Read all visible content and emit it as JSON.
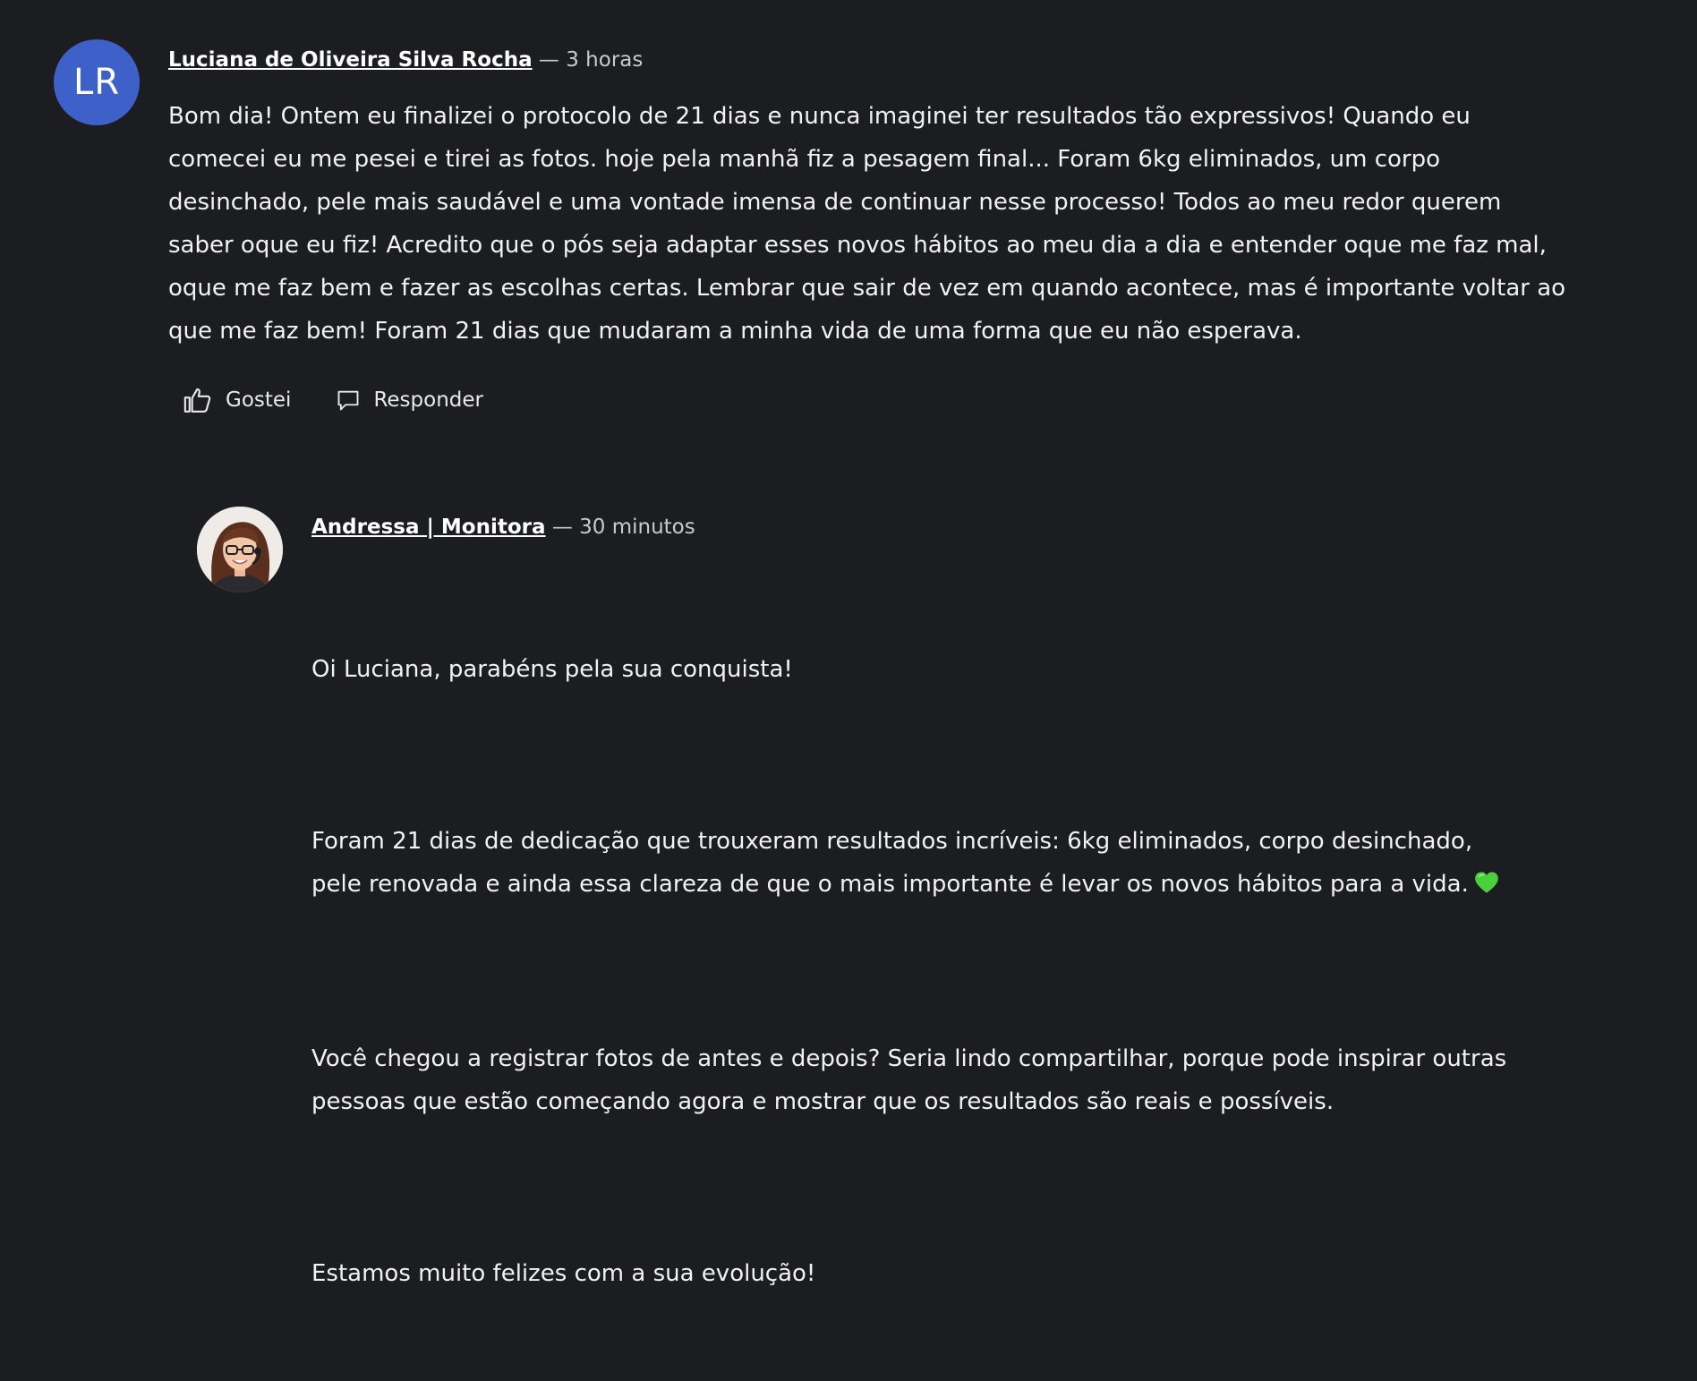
{
  "main_comment": {
    "avatar_initials": "LR",
    "author": "Luciana de Oliveira Silva Rocha",
    "timestamp": "— 3 horas",
    "text": "Bom dia! Ontem eu finalizei o protocolo de 21 dias e nunca imaginei ter resultados tão expressivos! Quando eu comecei eu me pesei e tirei as fotos. hoje pela manhã fiz a pesagem final... Foram 6kg eliminados, um corpo desinchado, pele mais saudável e uma vontade imensa de continuar nesse processo! Todos ao meu redor querem saber oque eu fiz! Acredito que o pós seja adaptar esses novos hábitos ao meu dia a dia e entender oque me faz mal, oque me faz bem e fazer as escolhas certas. Lembrar que sair de vez em quando acontece, mas é importante voltar ao que me faz bem! Foram 21 dias que mudaram a minha vida de uma forma que eu não esperava.",
    "actions": {
      "like_label": "Gostei",
      "reply_label": "Responder"
    }
  },
  "reply_comment": {
    "author": "Andressa | Monitora",
    "timestamp": "— 30 minutos",
    "paragraphs": [
      "Oi Luciana, parabéns pela sua conquista!",
      "Foram 21 dias de dedicação que trouxeram resultados incríveis: 6kg eliminados, corpo desinchado, pele renovada e ainda essa clareza de que o mais importante é levar os novos hábitos para a vida.",
      "Você chegou a registrar fotos de antes e depois? Seria lindo compartilhar, porque pode inspirar outras pessoas que estão começando agora e mostrar que os resultados são reais e possíveis.",
      "Estamos muito felizes com a sua evolução!"
    ],
    "emoji_icon": "green-heart-icon"
  },
  "colors": {
    "background": "#1c1d21",
    "avatar_blue": "#3e60c9",
    "heart_green": "#4ccf3c"
  }
}
